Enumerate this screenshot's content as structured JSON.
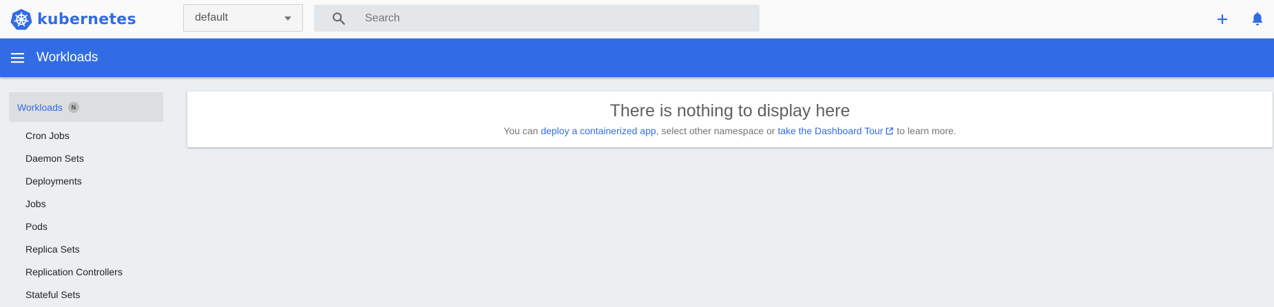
{
  "app": {
    "brand": "kubernetes",
    "brand_icon": "kubernetes-helm-icon",
    "brand_color": "#326ce5"
  },
  "topbar": {
    "namespace_selected": "default",
    "search": {
      "placeholder": "Search",
      "value": ""
    },
    "actions": [
      "plus-icon",
      "bell-icon"
    ]
  },
  "toolbar": {
    "menu_icon": "hamburger-menu-icon",
    "title": "Workloads",
    "color": "#326ce5"
  },
  "sidebar": {
    "header": {
      "label": "Workloads",
      "badge": "N"
    },
    "items": [
      {
        "label": "Cron Jobs"
      },
      {
        "label": "Daemon Sets"
      },
      {
        "label": "Deployments"
      },
      {
        "label": "Jobs"
      },
      {
        "label": "Pods"
      },
      {
        "label": "Replica Sets"
      },
      {
        "label": "Replication Controllers"
      },
      {
        "label": "Stateful Sets"
      }
    ]
  },
  "empty_state": {
    "title": "There is nothing to display here",
    "text_prefix": "You can ",
    "link_deploy": "deploy a containerized app",
    "text_middle": ", select other namespace or ",
    "link_tour": "take the Dashboard Tour",
    "text_suffix": " to learn more."
  }
}
